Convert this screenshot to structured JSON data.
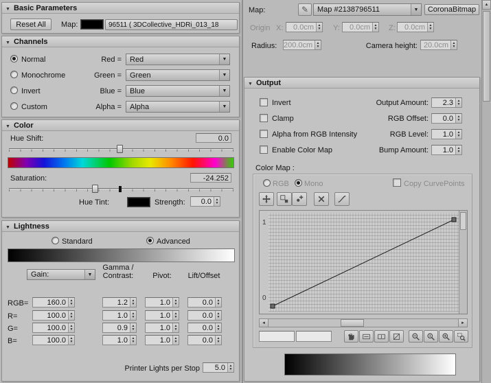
{
  "icons": {
    "pencil": "✎"
  },
  "left_panel": {
    "basic_parameters": {
      "title": "Basic Parameters",
      "reset_all_button": "Reset All",
      "map_label": "Map:",
      "map_name": "96511 ( 3DCollective_HDRi_013_18"
    },
    "channels": {
      "title": "Channels",
      "modes": [
        {
          "label": "Normal",
          "selected": true
        },
        {
          "label": "Monochrome",
          "selected": false
        },
        {
          "label": "Invert",
          "selected": false
        },
        {
          "label": "Custom",
          "selected": false
        }
      ],
      "mappings": [
        {
          "label": "Red =",
          "value": "Red"
        },
        {
          "label": "Green =",
          "value": "Green"
        },
        {
          "label": "Blue =",
          "value": "Blue"
        },
        {
          "label": "Alpha =",
          "value": "Alpha"
        }
      ]
    },
    "color": {
      "title": "Color",
      "hue_shift_label": "Hue Shift:",
      "hue_shift_value": "0.0",
      "saturation_label": "Saturation:",
      "saturation_value": "-24.252",
      "hue_tint_label": "Hue Tint:",
      "strength_label": "Strength:",
      "strength_value": "0.0",
      "hue_tint_color": "#000000"
    },
    "lightness": {
      "title": "Lightness",
      "mode_standard": "Standard",
      "mode_advanced": "Advanced",
      "selected_mode": "Advanced",
      "gain_dropdown": "Gain:",
      "col_header_line1": "Gamma /",
      "col_header_line2": "Contrast:",
      "col_pivot": "Pivot:",
      "col_lift": "Lift/Offset",
      "rows": [
        {
          "label": "RGB=",
          "value": "160.0",
          "gamma": "1.2",
          "pivot": "1.0",
          "lift": "0.0"
        },
        {
          "label": "R=",
          "value": "100.0",
          "gamma": "1.0",
          "pivot": "1.0",
          "lift": "0.0"
        },
        {
          "label": "G=",
          "value": "100.0",
          "gamma": "0.9",
          "pivot": "1.0",
          "lift": "0.0"
        },
        {
          "label": "B=",
          "value": "100.0",
          "gamma": "1.0",
          "pivot": "1.0",
          "lift": "0.0"
        }
      ],
      "printer_lights_label": "Printer Lights per Stop",
      "printer_lights_value": "5.0"
    }
  },
  "right_panel": {
    "map_row": {
      "map_label": "Map:",
      "map_selector": "Map #2138796511",
      "map_type_button": "CoronaBitmap"
    },
    "placement": {
      "origin_label": "Origin",
      "x_label": "X:",
      "x_value": "0.0cm",
      "y_label": "Y:",
      "y_value": "0.0cm",
      "z_label": "Z:",
      "z_value": "0.0cm",
      "radius_label": "Radius:",
      "radius_value": "200.0cm",
      "camera_height_label": "Camera height:",
      "camera_height_value": "20.0cm"
    },
    "output": {
      "title": "Output",
      "checkboxes": [
        {
          "label": "Invert",
          "checked": false
        },
        {
          "label": "Clamp",
          "checked": false
        },
        {
          "label": "Alpha from RGB Intensity",
          "checked": false
        },
        {
          "label": "Enable Color Map",
          "checked": false
        }
      ],
      "amounts": [
        {
          "label": "Output Amount:",
          "value": "2.3"
        },
        {
          "label": "RGB Offset:",
          "value": "0.0"
        },
        {
          "label": "RGB Level:",
          "value": "1.0"
        },
        {
          "label": "Bump Amount:",
          "value": "1.0"
        }
      ],
      "color_map": {
        "label": "Color Map :",
        "rgb_radio": "RGB",
        "mono_radio": "Mono",
        "selected": "Mono",
        "copy_curvepoints": "Copy CurvePoints",
        "curve_max": "1",
        "curve_min": "0"
      }
    }
  }
}
